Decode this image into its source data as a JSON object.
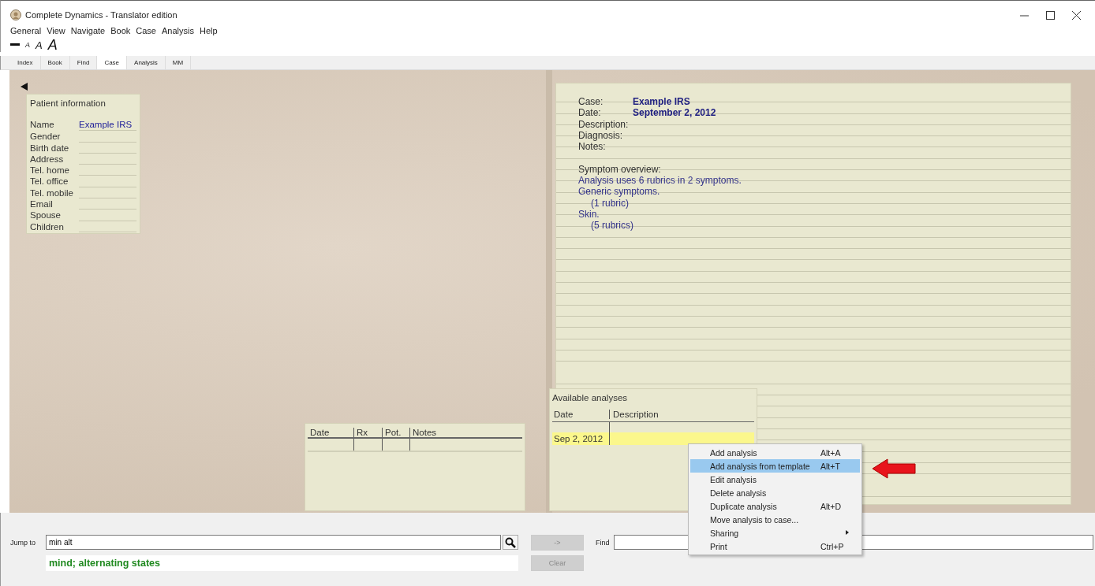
{
  "window": {
    "title": "Complete Dynamics - Translator edition"
  },
  "menu": [
    "General",
    "View",
    "Navigate",
    "Book",
    "Case",
    "Analysis",
    "Help"
  ],
  "toolbar": [
    {
      "kind": "small",
      "label": "A"
    },
    {
      "kind": "medium",
      "label": "A"
    },
    {
      "kind": "large",
      "label": "A"
    }
  ],
  "tabs": [
    {
      "label": "Index",
      "selected": false
    },
    {
      "label": "Book",
      "selected": false
    },
    {
      "label": "Find",
      "selected": false
    },
    {
      "label": "Case",
      "selected": true
    },
    {
      "label": "Analysis",
      "selected": false
    },
    {
      "label": "MM",
      "selected": false
    }
  ],
  "patient_info": {
    "title": "Patient information",
    "fields": [
      {
        "label": "Name",
        "value": "Example IRS"
      },
      {
        "label": "Gender"
      },
      {
        "label": "Birth date"
      },
      {
        "label": "Address"
      },
      {
        "label": "Tel. home"
      },
      {
        "label": "Tel. office"
      },
      {
        "label": "Tel. mobile"
      },
      {
        "label": "Email"
      },
      {
        "label": "Spouse"
      },
      {
        "label": "Children"
      }
    ]
  },
  "prescriptions": {
    "columns": [
      "Date",
      "Rx",
      "Pot.",
      "Notes"
    ]
  },
  "case_notes": {
    "fields": [
      {
        "label": "Case:",
        "value": "Example IRS"
      },
      {
        "label": "Date:",
        "value": "September 2, 2012"
      },
      {
        "label": "Description:"
      },
      {
        "label": "Diagnosis:"
      },
      {
        "label": "Notes:"
      }
    ],
    "symptom_overview": {
      "heading": "Symptom overview:",
      "lines": [
        {
          "kind": "summary",
          "text": "Analysis uses 6 rubrics in 2 symptoms."
        },
        {
          "kind": "group",
          "text": "Generic symptoms."
        },
        {
          "kind": "count",
          "text": "(1 rubric)"
        },
        {
          "kind": "group",
          "text": "Skin."
        },
        {
          "kind": "count",
          "text": "(5 rubrics)"
        }
      ]
    }
  },
  "available_analyses": {
    "title": "Available analyses",
    "columns": [
      "Date",
      "Description"
    ],
    "rows": [
      {
        "date": "Sep 2, 2012",
        "selected": true
      }
    ]
  },
  "context_menu": {
    "items": [
      {
        "kind": "item",
        "label": "Add analysis",
        "shortcut": "Alt+A",
        "selected": false
      },
      {
        "kind": "item",
        "label": "Add analysis from template",
        "shortcut": "Alt+T",
        "selected": true
      },
      {
        "kind": "item",
        "label": "Edit analysis",
        "selected": false
      },
      {
        "kind": "item",
        "label": "Delete analysis",
        "selected": false
      },
      {
        "kind": "item",
        "label": "Duplicate analysis",
        "shortcut": "Alt+D",
        "selected": false
      },
      {
        "kind": "item",
        "label": "Move analysis to case...",
        "selected": false
      },
      {
        "kind": "submenu",
        "label": "Sharing",
        "selected": false
      },
      {
        "kind": "item",
        "label": "Print",
        "shortcut": "Ctrl+P",
        "selected": false
      }
    ]
  },
  "bottom": {
    "jump_to": {
      "label": "Jump to",
      "value": "min alt"
    },
    "result": "mind; alternating states",
    "go_button": {
      "label": "->",
      "disabled": true
    },
    "clear_button": {
      "label": "Clear",
      "disabled": true
    },
    "find": {
      "label": "Find"
    }
  }
}
